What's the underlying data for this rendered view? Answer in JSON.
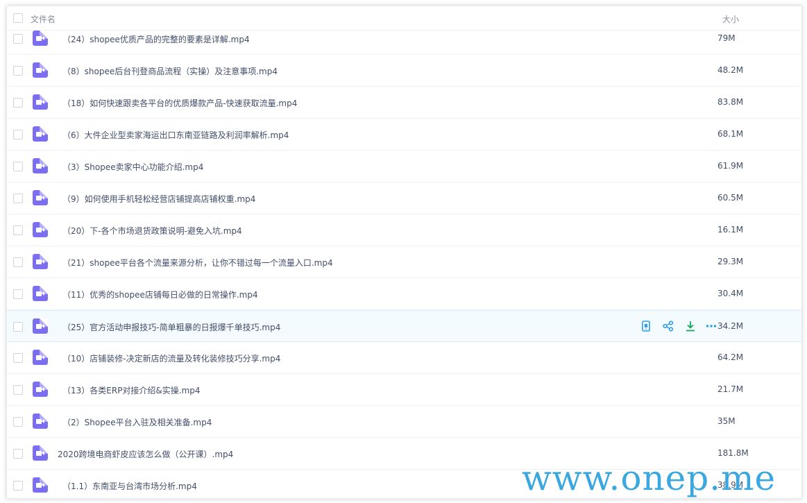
{
  "header": {
    "name_label": "文件名",
    "size_label": "大小"
  },
  "files": [
    {
      "name": "（24）shopee优质产品的完整的要素是详解.mp4",
      "size": "79M"
    },
    {
      "name": "（8）shopee后台刊登商品流程（实操）及注意事项.mp4",
      "size": "48.2M"
    },
    {
      "name": "（18）如何快速跟卖各平台的优质爆款产品-快速获取流量.mp4",
      "size": "83.8M"
    },
    {
      "name": "（6）大件企业型卖家海运出口东南亚链路及利润率解析.mp4",
      "size": "68.1M"
    },
    {
      "name": "（3）Shopee卖家中心功能介绍.mp4",
      "size": "61.9M"
    },
    {
      "name": "（9）如何使用手机轻松经营店铺提高店铺权重.mp4",
      "size": "60.5M"
    },
    {
      "name": "（20）下-各个市场退货政策说明-避免入坑.mp4",
      "size": "16.1M"
    },
    {
      "name": "（21）shopee平台各个流量来源分析，让你不错过每一个流量入口.mp4",
      "size": "29.3M"
    },
    {
      "name": "（11）优秀的shopee店铺每日必做的日常操作.mp4",
      "size": "30.4M"
    },
    {
      "name": "（25）官方活动申报技巧-简单粗暴的日报爆千单技巧.mp4",
      "size": "34.2M"
    },
    {
      "name": "（10）店铺装修-决定新店的流量及转化装修技巧分享.mp4",
      "size": "64.2M"
    },
    {
      "name": "（13）各类ERP对接介绍&实操.mp4",
      "size": "21.7M"
    },
    {
      "name": "（2）Shopee平台入驻及相关准备.mp4",
      "size": "35M"
    },
    {
      "name": "2020跨境电商虾皮应该怎么做（公开课）.mp4",
      "size": "181.8M"
    },
    {
      "name": "（1.1）东南亚与台湾市场分析.mp4",
      "size": "38.9M"
    }
  ],
  "hover_actions": [
    "phone-icon",
    "share-icon",
    "download-icon",
    "more-icon"
  ],
  "colors": {
    "video_icon": "#7b6ef0",
    "action_blue": "#2f9ee8",
    "download_green": "#1aa55d",
    "hover_row": "#f4fbff"
  },
  "watermark": "www.onep.me"
}
